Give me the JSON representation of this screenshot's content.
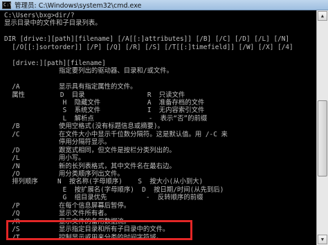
{
  "window": {
    "title": "管理员: C:\\Windows\\system32\\cmd.exe",
    "icon_label": "C:\\"
  },
  "console_lines": [
    "C:\\Users\\bxg>dir/?",
    "显示目录中的文件和子目录列表。",
    "",
    "DIR [drive:][path][filename] [/A[[:]attributes]] [/B] [/C] [/D] [/L] [/N]",
    "  [/O[[:]sortorder]] [/P] [/Q] [/R] [/S] [/T[[:]timefield]] [/W] [/X] [/4]",
    "",
    "  [drive:][path][filename]",
    "              指定要列出的驱动器、目录和/或文件。",
    "",
    "  /A          显示具有指定属性的文件。",
    "  属性         D  目录                R  只读文件",
    "               H  隐藏文件            A  准备存档的文件",
    "               S  系统文件            I  无内容索引文件",
    "               L  解析点              -  表示“否”的前缀",
    "  /B          使用空格式(没有标题信息或摘要)。",
    "  /C          在文件大小中显示千位数分隔符。这是默认值。用 /-C 来",
    "              停用分隔符显示。",
    "  /D          跟宽式相同，但文件是按栏分类列出的。",
    "  /L          用小写。",
    "  /N          新的长列表格式，其中文件名在最右边。",
    "  /O          用分类顺序列出文件。",
    "  排列顺序     N  按名称(字母顺序)    S  按大小(从小到大)",
    "               E  按扩展名(字母顺序)  D  按日期/时间(从先到后)",
    "               G  组目录优先          -  反转顺序的前缀",
    "  /P          在每个信息屏幕后暂停。",
    "  /Q          显示文件所有者。",
    "  /R          显示文件的备用数据流。",
    "  /S          显示指定目录和所有子目录中的文件。",
    "  /T          控制显示或用来分类的时间字符域。"
  ],
  "scrollbar": {
    "up_arrow_icon": "triangle-up",
    "down_arrow_icon": "triangle-down"
  },
  "colors": {
    "console_background": "#000000",
    "console_text": "#c0c0c0",
    "highlight_border": "#e32626"
  }
}
